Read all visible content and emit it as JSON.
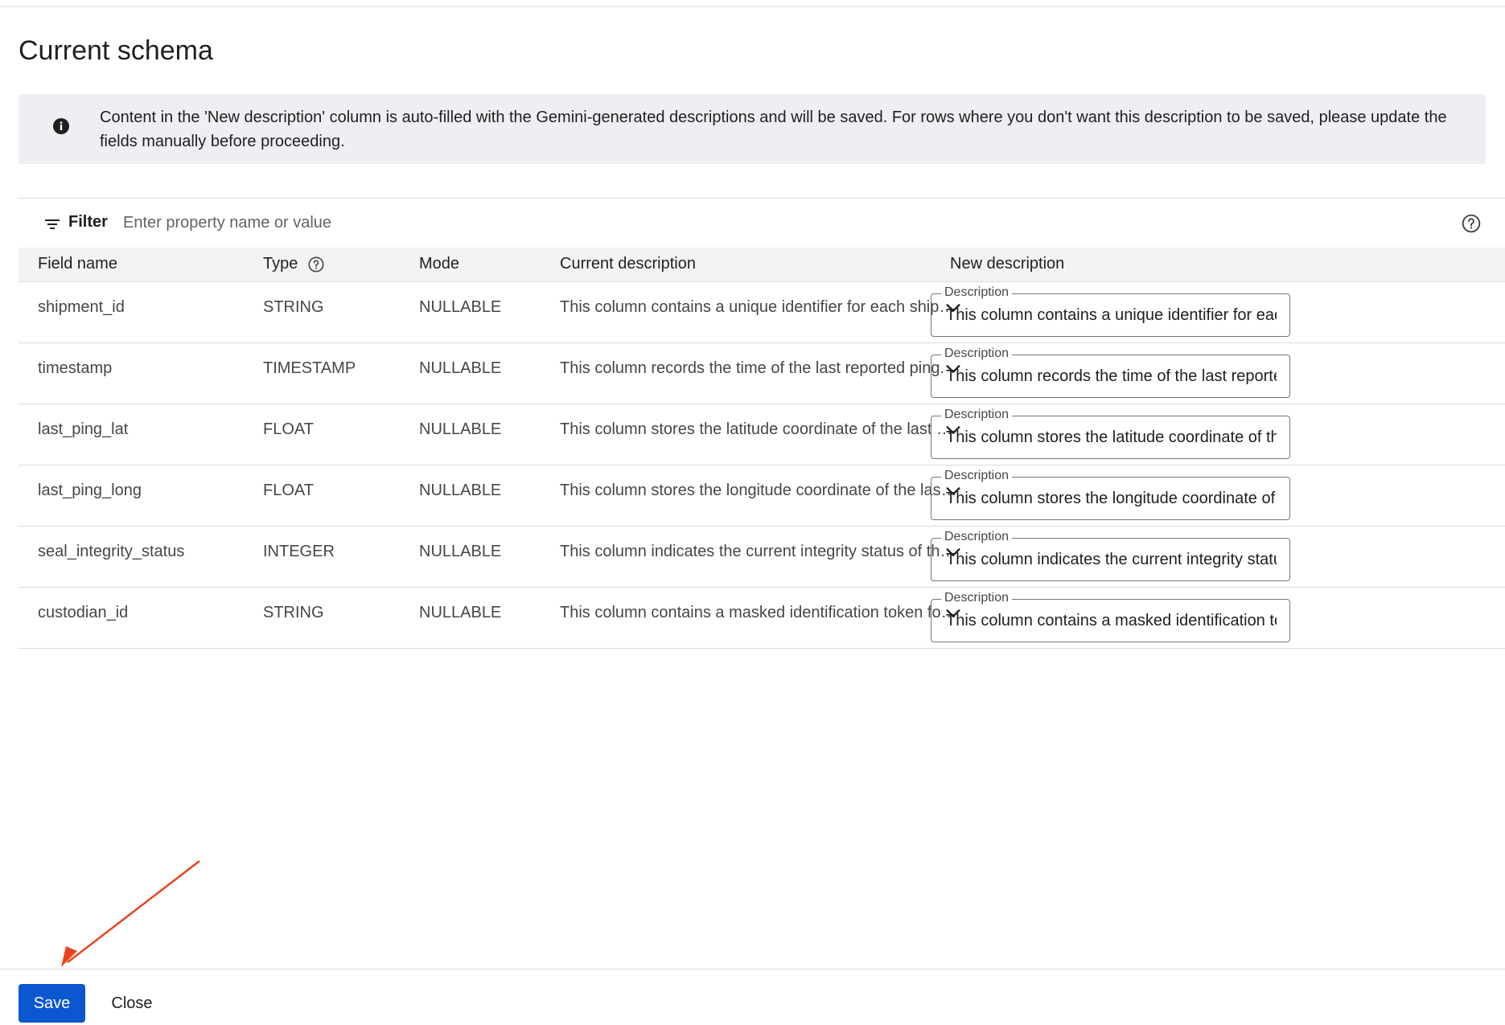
{
  "page": {
    "title": "Current schema"
  },
  "banner": {
    "text": "Content in the 'New description' column is auto-filled with the Gemini-generated descriptions and will be saved. For rows where you don't want this description to be saved, please update the fields manually before proceeding.",
    "icon": "info-icon"
  },
  "filter": {
    "label": "Filter",
    "placeholder": "Enter property name or value",
    "icon": "filter-icon",
    "help_icon": "help-icon"
  },
  "table": {
    "headers": {
      "field_name": "Field name",
      "type": "Type",
      "mode": "Mode",
      "current_description": "Current description",
      "new_description": "New description"
    },
    "field_label": "Description",
    "rows": [
      {
        "field_name": "shipment_id",
        "type": "STRING",
        "mode": "NULLABLE",
        "current_description": "This column contains a unique identifier for each shipment.",
        "new_description": "This column contains a unique identifier for each shipment."
      },
      {
        "field_name": "timestamp",
        "type": "TIMESTAMP",
        "mode": "NULLABLE",
        "current_description": "This column records the time of the last reported ping.",
        "new_description": "This column records the time of the last reported ping."
      },
      {
        "field_name": "last_ping_lat",
        "type": "FLOAT",
        "mode": "NULLABLE",
        "current_description": "This column stores the latitude coordinate of the last ping.",
        "new_description": "This column stores the latitude coordinate of the last ping."
      },
      {
        "field_name": "last_ping_long",
        "type": "FLOAT",
        "mode": "NULLABLE",
        "current_description": "This column stores the longitude coordinate of the last ping.",
        "new_description": "This column stores the longitude coordinate of the last ping."
      },
      {
        "field_name": "seal_integrity_status",
        "type": "INTEGER",
        "mode": "NULLABLE",
        "current_description": "This column indicates the current integrity status of the seal.",
        "new_description": "This column indicates the current integrity status of the seal."
      },
      {
        "field_name": "custodian_id",
        "type": "STRING",
        "mode": "NULLABLE",
        "current_description": "This column contains a masked identification token for the custodian.",
        "new_description": "This column contains a masked identification token for the custodian."
      }
    ]
  },
  "footer": {
    "save_label": "Save",
    "close_label": "Close"
  },
  "colors": {
    "primary": "#0b57d0",
    "annotation_arrow": "#e8451f",
    "banner_bg": "#edeff2"
  }
}
